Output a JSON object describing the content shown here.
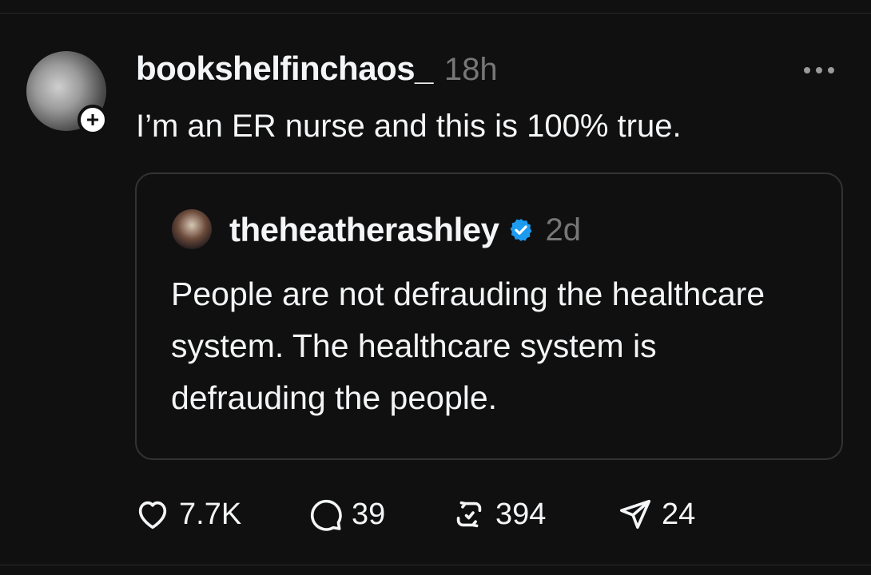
{
  "post": {
    "username": "bookshelfinchaos_",
    "time": "18h",
    "text": "I’m an ER nurse and this is 100% true.",
    "follow_icon": "plus-icon",
    "more_icon": "more-icon"
  },
  "quote": {
    "username": "theheatherashley",
    "verified": true,
    "time": "2d",
    "text": "People are not defrauding the healthcare system. The healthcare system is defrauding the people."
  },
  "actions": {
    "likes": "7.7K",
    "replies": "39",
    "reposts": "394",
    "shares": "24"
  },
  "colors": {
    "background": "#101010",
    "text": "#f3f5f7",
    "muted": "#777777",
    "verified": "#1d9bf0",
    "border": "#333333"
  }
}
